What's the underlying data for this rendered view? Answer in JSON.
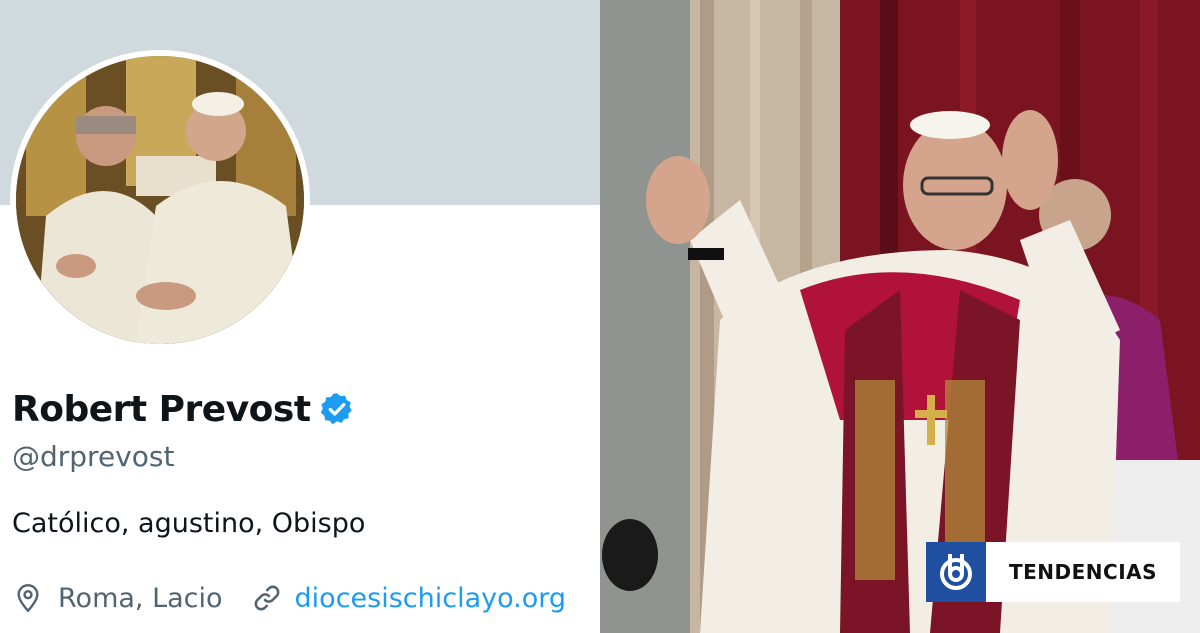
{
  "profile": {
    "display_name": "Robert Prevost",
    "verified_icon": "verified-badge-icon",
    "handle": "@drprevost",
    "bio": "Católico, agustino, Obispo",
    "location_icon": "location-pin-icon",
    "location": "Roma, Lacio",
    "link_icon": "link-icon",
    "link": "diocesischiclayo.org",
    "colors": {
      "banner": "#cfd9de",
      "name": "#0f1419",
      "secondary": "#536471",
      "link": "#1d9bf0",
      "verified": "#1d9bf0"
    }
  },
  "badge": {
    "logo_icon": "biobio-logo-icon",
    "label": "TENDENCIAS",
    "logo_color": "#1f4fa0"
  }
}
